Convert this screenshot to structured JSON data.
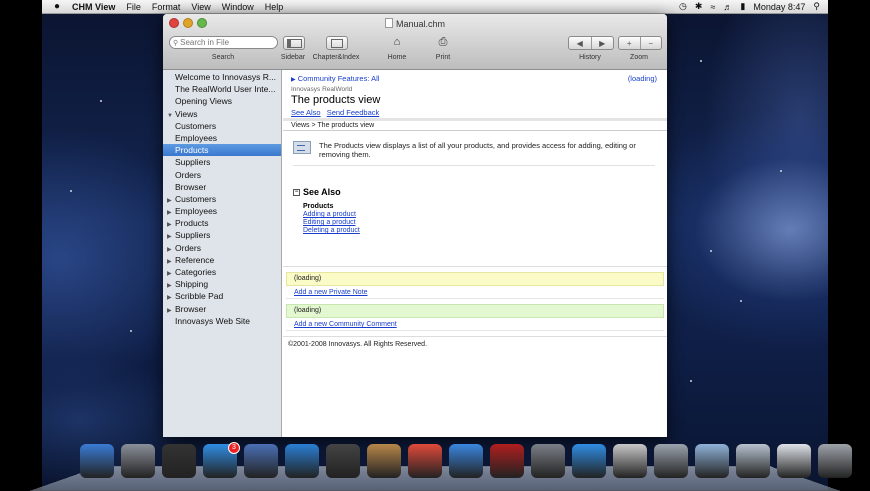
{
  "menubar": {
    "apple": "",
    "app_name": "CHM View",
    "items": [
      "File",
      "Format",
      "View",
      "Window",
      "Help"
    ],
    "clock": "Monday 8:47"
  },
  "window": {
    "title": "Manual.chm",
    "search_placeholder": "Search in File",
    "toolbar": {
      "search_label": "Search",
      "sidebar_label": "Sidebar",
      "chapter_label": "Chapter&Index",
      "home_label": "Home",
      "print_label": "Print",
      "history_label": "History",
      "zoom_label": "Zoom",
      "back_glyph": "◀",
      "forward_glyph": "▶",
      "zoom_in": "+",
      "zoom_out": "−"
    }
  },
  "sidebar": {
    "items": [
      {
        "label": "Welcome to Innovasys R...",
        "arrow": ""
      },
      {
        "label": "The RealWorld User Inte...",
        "arrow": ""
      },
      {
        "label": "Opening Views",
        "arrow": ""
      },
      {
        "label": "Views",
        "arrow": "▼"
      },
      {
        "label": "Customers",
        "arrow": ""
      },
      {
        "label": "Employees",
        "arrow": ""
      },
      {
        "label": "Products",
        "arrow": ""
      },
      {
        "label": "Suppliers",
        "arrow": ""
      },
      {
        "label": "Orders",
        "arrow": ""
      },
      {
        "label": "Browser",
        "arrow": ""
      },
      {
        "label": "Customers",
        "arrow": "▶"
      },
      {
        "label": "Employees",
        "arrow": "▶"
      },
      {
        "label": "Products",
        "arrow": "▶"
      },
      {
        "label": "Suppliers",
        "arrow": "▶"
      },
      {
        "label": "Orders",
        "arrow": "▶"
      },
      {
        "label": "Reference",
        "arrow": "▶"
      },
      {
        "label": "Categories",
        "arrow": "▶"
      },
      {
        "label": "Shipping",
        "arrow": "▶"
      },
      {
        "label": "Scribble Pad",
        "arrow": "▶"
      },
      {
        "label": "Browser",
        "arrow": "▶"
      },
      {
        "label": "Innovasys Web Site",
        "arrow": ""
      }
    ],
    "selected_index": 6
  },
  "content": {
    "community": "Community Features: All",
    "loading_top": "(loading)",
    "company": "Innovasys RealWorld",
    "page_title": "The products view",
    "see_also_link": "See Also",
    "feedback_link": "Send Feedback",
    "breadcrumb": "Views > The products view",
    "description": "The Products view displays a list of all your products, and provides access for adding, editing or removing them.",
    "see_also_heading": "See Also",
    "see_also_group": "Products",
    "see_also_links": [
      "Adding a product",
      "Editing a product",
      "Deleting a product"
    ],
    "private_loading": "(loading)",
    "add_private_note": "Add a new Private Note",
    "community_loading": "(loading)",
    "add_community_comment": "Add a new Community Comment",
    "copyright": "©2001-2008 Innovasys. All Rights Reserved."
  },
  "dock": {
    "items": [
      {
        "name": "finder-icon",
        "color": "#3a7bd5"
      },
      {
        "name": "launchpad-icon",
        "color": "#8a8f99"
      },
      {
        "name": "mission-control-icon",
        "color": "#333333"
      },
      {
        "name": "app-store-icon",
        "color": "#2f8de4",
        "badge": "3"
      },
      {
        "name": "preview-icon",
        "color": "#4a6fb5"
      },
      {
        "name": "safari-icon",
        "color": "#2a7fd4"
      },
      {
        "name": "facetime-icon",
        "color": "#444444"
      },
      {
        "name": "address-book-icon",
        "color": "#b8864a"
      },
      {
        "name": "ical-icon",
        "color": "#e04a3a"
      },
      {
        "name": "itunes-icon",
        "color": "#3a86e0"
      },
      {
        "name": "photo-booth-icon",
        "color": "#b01e1e"
      },
      {
        "name": "system-preferences-icon",
        "color": "#7b7f87"
      },
      {
        "name": "chm-view-icon",
        "color": "#2f8de4"
      },
      {
        "name": "document-viewer-icon",
        "color": "#c8c8c8"
      },
      {
        "name": "magnifier-icon",
        "color": "#9aa3ad"
      },
      {
        "name": "applications-folder-icon",
        "color": "#8fb3d9"
      },
      {
        "name": "documents-folder-icon",
        "color": "#b6c2cf"
      },
      {
        "name": "downloads-stack-icon",
        "color": "#dfe3e8"
      },
      {
        "name": "trash-icon",
        "color": "#9ea3aa"
      }
    ]
  }
}
